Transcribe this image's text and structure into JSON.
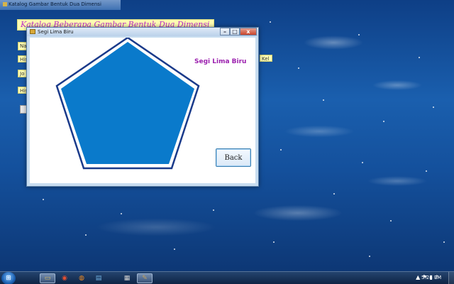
{
  "main_window": {
    "title": "Katalog Gambar Bentuk Dua Dimensi",
    "heading": "Katalog Beberapa Gambar Bentuk Dua Dimensi",
    "partial_labels": [
      "Na",
      "His",
      "Jo",
      "His"
    ],
    "right_label_fragment": "Kel"
  },
  "dialog": {
    "title": "Segi Lima Biru",
    "shape_label": "Segi Lima Biru",
    "back_label": "Back",
    "shape_fill": "#0a7acb",
    "shape_stroke": "#1a3a8a",
    "minimize_label": "–",
    "maximize_label": "□",
    "close_label": "x"
  },
  "taskbar": {
    "start_glyph": "⊞",
    "items": [
      {
        "icon": "folder-icon",
        "glyph": "▭",
        "color": "#e0c060"
      },
      {
        "icon": "chrome-icon",
        "glyph": "◉",
        "color": "#e85030"
      },
      {
        "icon": "firefox-icon",
        "glyph": "◍",
        "color": "#f08a20"
      },
      {
        "icon": "media-icon",
        "glyph": "▤",
        "color": "#70b0e0"
      },
      {
        "icon": "app-icon",
        "glyph": "▦",
        "color": "#d0d0d0"
      },
      {
        "icon": "vb-icon",
        "glyph": "✎",
        "color": "#c0a060"
      }
    ],
    "tray_icons": [
      "▲",
      "⚑",
      "▮",
      "♪"
    ],
    "clock": "5:24 PM"
  }
}
